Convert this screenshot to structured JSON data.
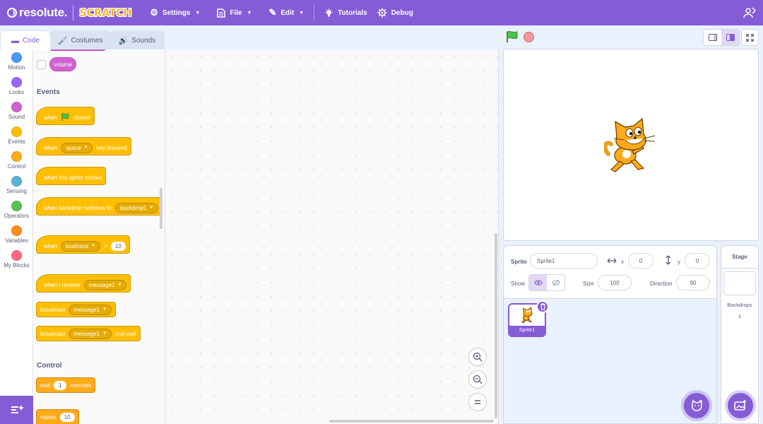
{
  "menubar": {
    "logo_text": "resolute.",
    "scratch_logo": "SCRATCH",
    "settings": "Settings",
    "file": "File",
    "edit": "Edit",
    "tutorials": "Tutorials",
    "debug": "Debug"
  },
  "tabs": {
    "code": "Code",
    "costumes": "Costumes",
    "sounds": "Sounds"
  },
  "categories": [
    {
      "label": "Motion",
      "color": "#4c97ff"
    },
    {
      "label": "Looks",
      "color": "#9966ff"
    },
    {
      "label": "Sound",
      "color": "#cf63cf"
    },
    {
      "label": "Events",
      "color": "#ffbf00"
    },
    {
      "label": "Control",
      "color": "#ffab19"
    },
    {
      "label": "Sensing",
      "color": "#5cb1d6"
    },
    {
      "label": "Operators",
      "color": "#59c059"
    },
    {
      "label": "Variables",
      "color": "#ff8c1a"
    },
    {
      "label": "My Blocks",
      "color": "#ff6680"
    }
  ],
  "palette": {
    "volume": "volume",
    "events_title": "Events",
    "when": "when",
    "clicked": "clicked",
    "space": "space",
    "key_pressed": "key pressed",
    "when_sprite_clicked": "when this sprite clicked",
    "when_backdrop_switches": "when backdrop switches to",
    "backdrop1": "backdrop1",
    "loudness": "loudness",
    "gt": ">",
    "loudness_value": "10",
    "when_i_receive": "when I receive",
    "message1": "message1",
    "broadcast": "broadcast",
    "and_wait": "and wait",
    "control_title": "Control",
    "wait": "wait",
    "wait_value": "1",
    "seconds": "seconds",
    "repeat": "repeat",
    "repeat_value": "10"
  },
  "sprite_info": {
    "sprite_label": "Sprite",
    "sprite_name": "Sprite1",
    "x_label": "x",
    "x_value": "0",
    "y_label": "y",
    "y_value": "0",
    "show_label": "Show",
    "size_label": "Size",
    "size_value": "100",
    "direction_label": "Direction",
    "direction_value": "90"
  },
  "sprites": [
    {
      "name": "Sprite1"
    }
  ],
  "stage_pane": {
    "title": "Stage",
    "backdrops_label": "Backdrops",
    "backdrops_count": "1"
  },
  "colors": {
    "accent": "#855cd6",
    "events": "#ffbf00",
    "control": "#ffab19",
    "sound": "#cf63cf"
  }
}
